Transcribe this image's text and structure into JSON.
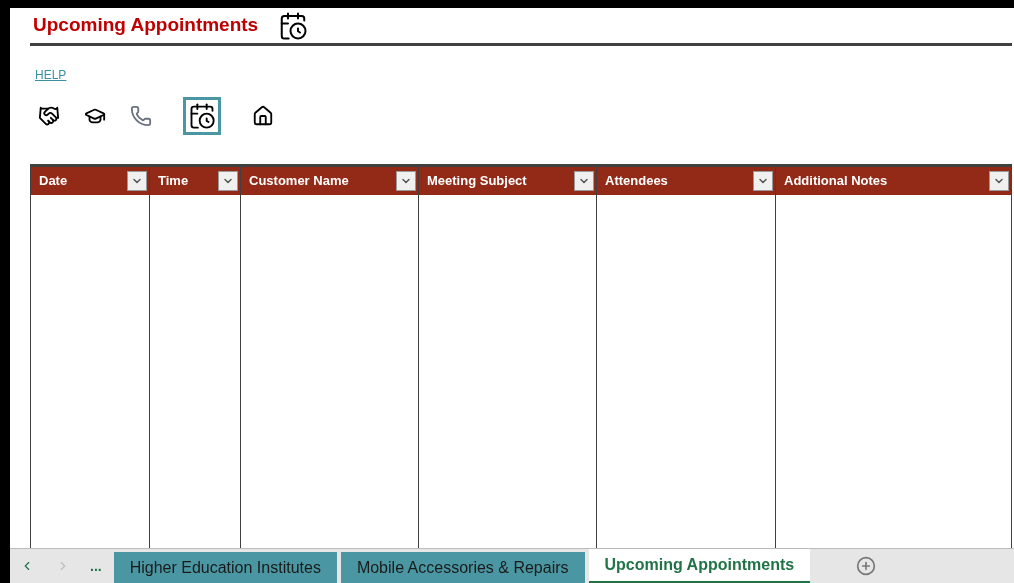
{
  "header": {
    "title": "Upcoming Appointments",
    "help_link": "HELP"
  },
  "toolbar": [
    {
      "kind": "handshake",
      "selected": false
    },
    {
      "kind": "graduation",
      "selected": false
    },
    {
      "kind": "phone",
      "selected": false
    },
    {
      "kind": "calendar",
      "selected": true
    },
    {
      "kind": "home",
      "selected": false
    }
  ],
  "table": {
    "columns": [
      "Date",
      "Time",
      "Customer Name",
      "Meeting Subject",
      "Attendees",
      "Additional Notes"
    ]
  },
  "sheet_tabs": {
    "overflow": "...",
    "tabs": [
      {
        "label": "Higher Education Institutes",
        "selected": false
      },
      {
        "label": "Mobile Accessories & Repairs",
        "selected": false
      },
      {
        "label": "Upcoming Appointments",
        "selected": true
      }
    ]
  }
}
